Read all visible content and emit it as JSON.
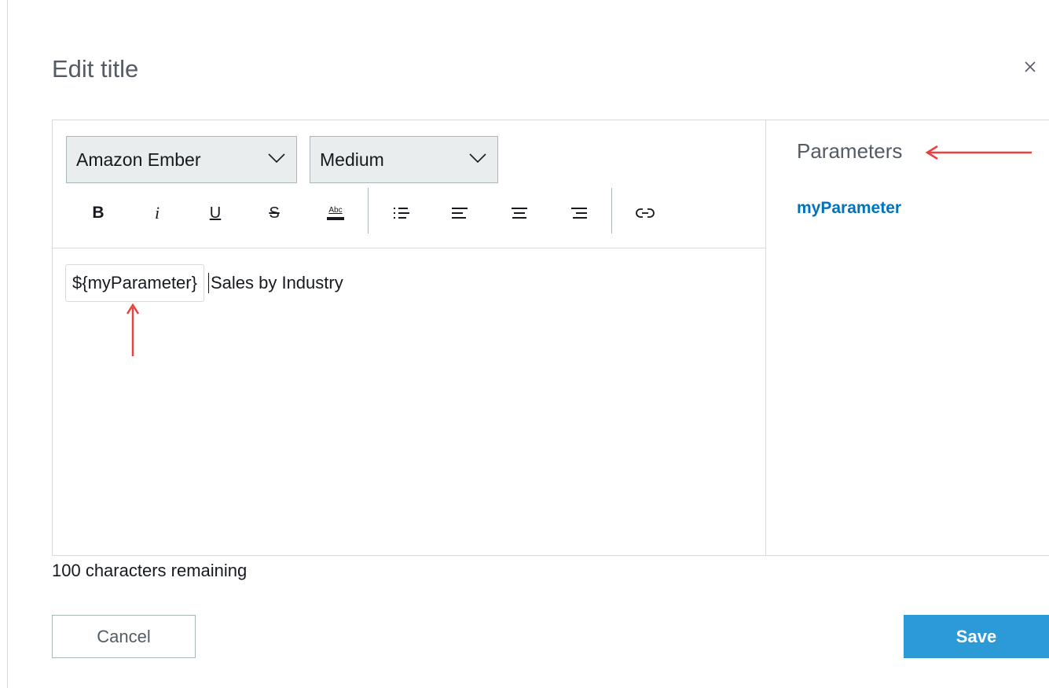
{
  "dialog": {
    "title": "Edit title",
    "close_icon": "close-icon"
  },
  "toolbar": {
    "font_family": "Amazon Ember",
    "font_size": "Medium",
    "tools": [
      {
        "name": "bold",
        "glyph": "B"
      },
      {
        "name": "italic",
        "glyph": "i"
      },
      {
        "name": "underline",
        "glyph": "U"
      },
      {
        "name": "strikethrough",
        "glyph": "S"
      },
      {
        "name": "text-color",
        "glyph": "Abc"
      },
      {
        "name": "bulleted-list"
      },
      {
        "name": "align-left"
      },
      {
        "name": "align-center"
      },
      {
        "name": "align-right"
      },
      {
        "name": "link"
      }
    ]
  },
  "editor": {
    "parameter_token": "${myParameter}",
    "title_text": "Sales by Industry"
  },
  "parameters": {
    "heading": "Parameters",
    "items": [
      "myParameter"
    ]
  },
  "footer": {
    "chars_remaining": "100 characters remaining",
    "cancel_label": "Cancel",
    "save_label": "Save"
  },
  "colors": {
    "primary_button": "#2b9ad6",
    "link": "#0073bb",
    "annotation_arrow": "#e8423f",
    "border": "#d5dbdb"
  }
}
